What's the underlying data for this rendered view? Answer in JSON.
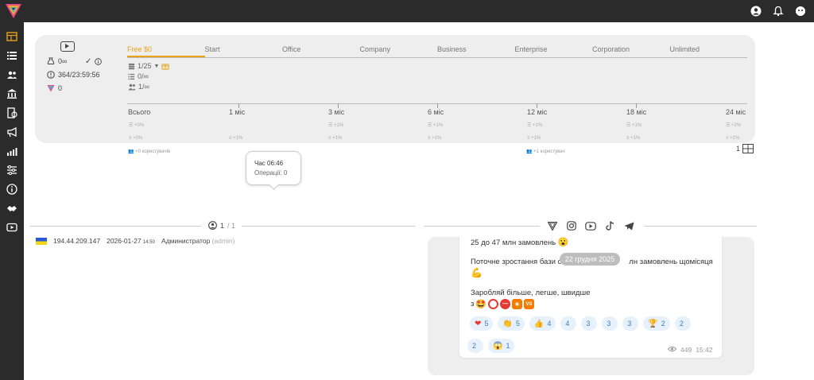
{
  "sidebar": {
    "items": [
      {
        "icon": "dashboard-icon",
        "active": true
      },
      {
        "icon": "list-icon"
      },
      {
        "icon": "users-icon"
      },
      {
        "icon": "bank-icon"
      },
      {
        "icon": "voucher-icon"
      },
      {
        "icon": "megaphone-icon"
      },
      {
        "icon": "stats-icon"
      },
      {
        "icon": "sliders-icon"
      },
      {
        "icon": "info-icon"
      },
      {
        "icon": "handshake-icon"
      },
      {
        "icon": "video-icon"
      }
    ]
  },
  "stats": {
    "balance": "0∞",
    "timer": "364/23:59:56",
    "points": "0"
  },
  "plans": {
    "tabs": [
      "Free $0",
      "Start",
      "Office",
      "Company",
      "Business",
      "Enterprise",
      "Corporation",
      "Unlimited"
    ],
    "active_index": 0,
    "limits": {
      "files": "1/25",
      "ops": "0/∞",
      "users": "1/∞"
    }
  },
  "periods": {
    "labels": [
      "Всього",
      "1 міс",
      "3 міс",
      "6 міс",
      "12 міс",
      "18 міс",
      "24 міс"
    ],
    "row1": [
      "+0%",
      "+1%",
      "+1%",
      "+1%",
      "+1%",
      "+1%",
      "+2%"
    ],
    "row2": [
      "+0%",
      "+1%",
      "+1%",
      "+1%",
      "+1%",
      "+1%",
      "+1%"
    ],
    "users_all": "+0 користувачів",
    "users_12": "+1 користувач"
  },
  "pager_right": {
    "value": "1"
  },
  "tooltip": {
    "time": "Час 06:46",
    "ops": "Операції: 0"
  },
  "sessions_pager": {
    "current": "1",
    "total": "/ 1"
  },
  "session": {
    "ip": "194.44.209.147",
    "date": "2026-01-27",
    "time": "14:50",
    "role": "Администратор",
    "role_sub": "(admin)"
  },
  "news": {
    "line1": "25 до 47 млн замовлень",
    "date_pill": "22 грудня 2025",
    "line2": "Поточне зростання бази с",
    "line2b": "лн замовлень щомісяця",
    "line3": "Заробляй більше, легше, швидше",
    "line4_prefix": "з",
    "reactions_row1": [
      {
        "e": "❤",
        "n": "5"
      },
      {
        "e": "👏",
        "n": "5"
      },
      {
        "e": "👍",
        "n": "4"
      },
      {
        "e": "",
        "n": "4"
      },
      {
        "e": "",
        "n": "3"
      },
      {
        "e": "",
        "n": "3"
      },
      {
        "e": "",
        "n": "3"
      },
      {
        "e": "🏆",
        "n": "2"
      },
      {
        "e": "",
        "n": "2"
      }
    ],
    "reactions_row2": [
      {
        "e": "",
        "n": "2"
      },
      {
        "e": "😱",
        "n": "1"
      }
    ],
    "views": "449",
    "time": "15:42"
  }
}
